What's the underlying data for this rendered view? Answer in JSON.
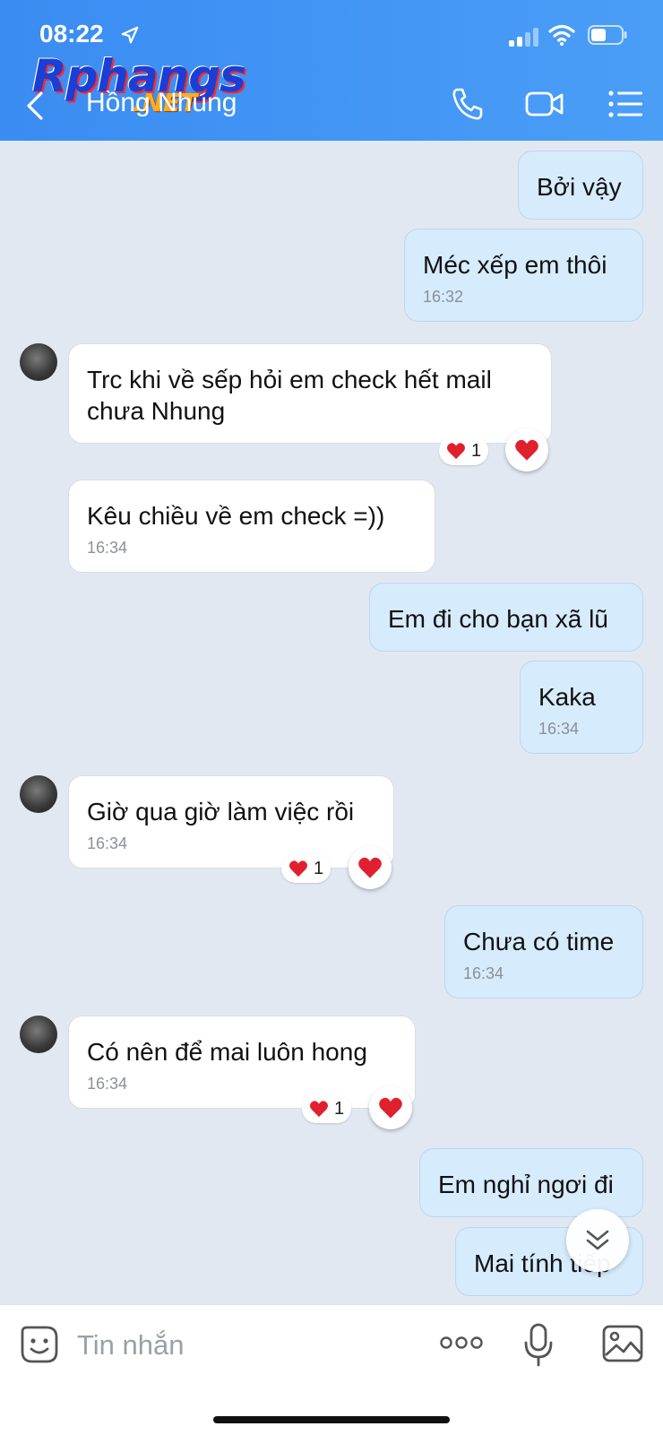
{
  "status_bar": {
    "time": "08:22"
  },
  "watermark": {
    "main": "Rphangs",
    "sub": ".NET"
  },
  "header": {
    "title": "Hồng Nhung"
  },
  "messages": [
    {
      "side": "out",
      "text": "Bởi vậy"
    },
    {
      "side": "out",
      "text": "Méc xếp em thôi",
      "time": "16:32"
    },
    {
      "side": "in",
      "text": "Trc khi về sếp hỏi em check hết mail\nchưa Nhung",
      "reaction_count": "1"
    },
    {
      "side": "in",
      "text": "Kêu chiều về em check =))",
      "time": "16:34"
    },
    {
      "side": "out",
      "text": "Em đi cho bạn xã lũ"
    },
    {
      "side": "out",
      "text": "Kaka",
      "time": "16:34"
    },
    {
      "side": "in",
      "text": "Giờ qua giờ làm việc rồi",
      "time": "16:34",
      "reaction_count": "1"
    },
    {
      "side": "out",
      "text": "Chưa có time",
      "time": "16:34"
    },
    {
      "side": "in",
      "text": "Có nên để mai luôn hong",
      "time": "16:34",
      "reaction_count": "1"
    },
    {
      "side": "out",
      "text": "Em nghỉ ngơi đi"
    },
    {
      "side": "out",
      "text": "Mai tính tiếp"
    }
  ],
  "composer": {
    "placeholder": "Tin nhắn",
    "value": ""
  },
  "colors": {
    "header": "#3a8cf2",
    "outgoing_bubble": "#d6ebfb",
    "incoming_bubble": "#ffffff",
    "chat_bg": "#e2e8f2",
    "heart": "#e0202f"
  }
}
